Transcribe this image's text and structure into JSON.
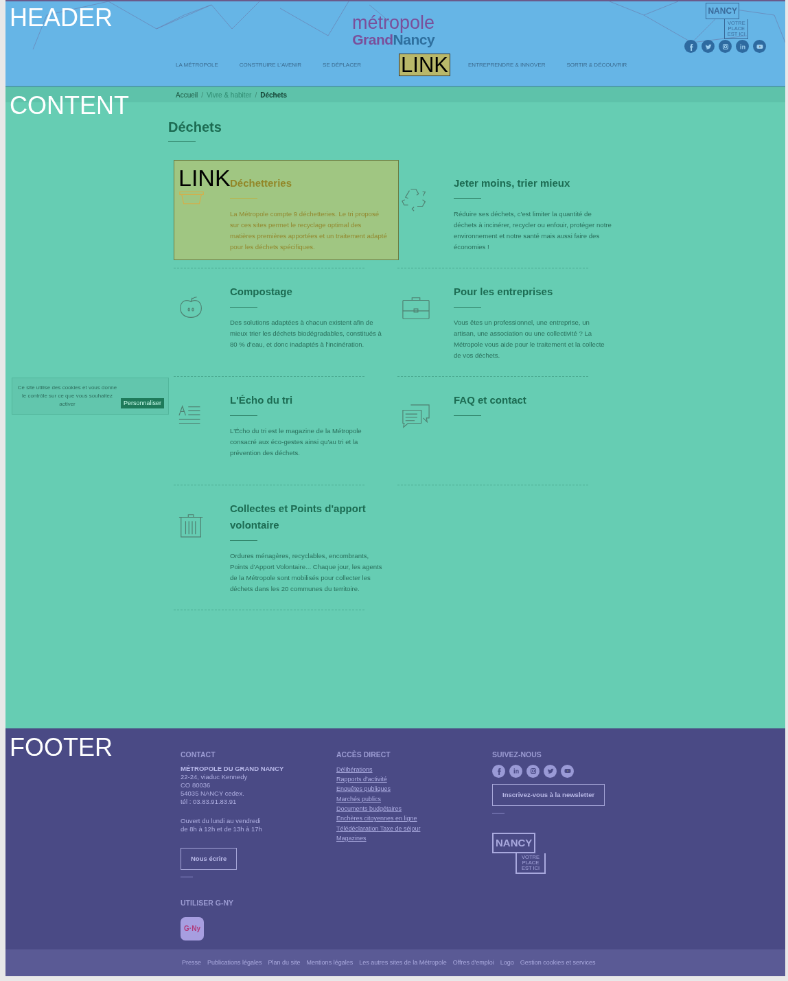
{
  "region_labels": {
    "header": "HEADER",
    "content": "CONTENT",
    "footer": "FOOTER"
  },
  "header": {
    "logo": {
      "line1": "métropole",
      "grand": "Grand",
      "nancy": "Nancy"
    },
    "badge": {
      "word": "NANCY",
      "tagline": [
        "VOTRE",
        "PLACE",
        "EST ICI"
      ]
    },
    "social": [
      {
        "kind": "facebook"
      },
      {
        "kind": "twitter"
      },
      {
        "kind": "instagram"
      },
      {
        "kind": "linkedin"
      },
      {
        "kind": "youtube"
      }
    ],
    "nav": [
      {
        "kind": "link",
        "label": "LA MÉTROPOLE"
      },
      {
        "kind": "link",
        "label": "CONSTRUIRE L'AVENIR"
      },
      {
        "kind": "link",
        "label": "SE DÉPLACER"
      },
      {
        "kind": "overlay",
        "label": "LINK"
      },
      {
        "kind": "link",
        "label": "ENTREPRENDRE & INNOVER"
      },
      {
        "kind": "link",
        "label": "SORTIR & DÉCOUVRIR"
      }
    ]
  },
  "breadcrumb": {
    "separator": "/",
    "items": [
      {
        "label": "Accueil",
        "current": false
      },
      {
        "label": "Vivre & habiter",
        "current": false
      },
      {
        "label": "Déchets",
        "current": true
      }
    ]
  },
  "title": "Déchets",
  "cards": [
    {
      "kind": "basket",
      "title": "Déchetteries",
      "text": "La Métropole compte 9 déchetteries. Le tri proposé sur ces sites permet le recyclage optimal des matières premières apportées et un traitement adapté pour les déchets spécifiques.",
      "overlay_label": "LINK"
    },
    {
      "kind": "recycle",
      "title": "Jeter moins, trier mieux",
      "text": "Réduire ses déchets, c'est limiter la quantité de déchets à incinérer, recycler ou enfouir, protéger notre environnement et notre santé mais aussi faire des économies !"
    },
    {
      "kind": "apple",
      "title": "Compostage",
      "text": "Des solutions adaptées à chacun existent afin de mieux trier les déchets biodégradables, constitués à 80 % d'eau, et donc inadaptés à l'incinération."
    },
    {
      "kind": "briefcase",
      "title": "Pour les entreprises",
      "text": "Vous êtes un professionnel, une entreprise, un artisan, une association ou une collectivité ? La Métropole vous aide pour le traitement et la collecte de vos déchets."
    },
    {
      "kind": "text-lines",
      "title": "L'Écho du tri",
      "text": "L'Écho du tri est le magazine de la Métropole consacré aux éco-gestes ainsi qu'au tri et la prévention des déchets."
    },
    {
      "kind": "chat",
      "title": "FAQ et contact"
    },
    {
      "kind": "trash",
      "title": "Collectes et Points d'apport volontaire",
      "text": "Ordures ménagères, recyclables, encombrants, Points d'Apport Volontaire... Chaque jour, les agents de la Métropole sont mobilisés pour collecter les déchets dans les 20 communes du territoire."
    }
  ],
  "cookie_banner": {
    "text": "Ce site utilise des cookies et vous donne le contrôle sur ce que vous souhaitez activer",
    "button": "Personnaliser"
  },
  "footer": {
    "contact": {
      "heading": "CONTACT",
      "org": "MÉTROPOLE DU GRAND NANCY",
      "address": [
        "22-24, viaduc Kennedy",
        "CO 80036",
        "54035 NANCY cedex.",
        "tél : 03.83.91.83.91"
      ],
      "hours": [
        "Ouvert du lundi au vendredi",
        "de 8h à 12h et de 13h à 17h"
      ],
      "button": "Nous écrire"
    },
    "app": {
      "heading": "UTILISER G-NY",
      "icon_text": "G·Ny"
    },
    "direct": {
      "heading": "ACCÈS DIRECT",
      "links": [
        "Délibérations",
        "Rapports d'activité",
        "Enquêtes publiques",
        "Marchés publics",
        "Documents budgétaires",
        "Enchères citoyennes en ligne",
        "Télédéclaration Taxe de séjour",
        "Magazines"
      ]
    },
    "follow": {
      "heading": "SUIVEZ-NOUS",
      "social": [
        {
          "kind": "facebook"
        },
        {
          "kind": "linkedin"
        },
        {
          "kind": "instagram"
        },
        {
          "kind": "twitter"
        },
        {
          "kind": "youtube"
        }
      ],
      "button": "Inscrivez-vous à la newsletter",
      "badge": {
        "word": "NANCY",
        "tagline": [
          "VOTRE",
          "PLACE",
          "EST ICI"
        ]
      }
    },
    "bottom_links": [
      "Presse",
      "Publications légales",
      "Plan du site",
      "Mentions légales",
      "Les autres sites de la Métropole",
      "Offres d'emploi",
      "Logo",
      "Gestion cookies et services"
    ]
  }
}
